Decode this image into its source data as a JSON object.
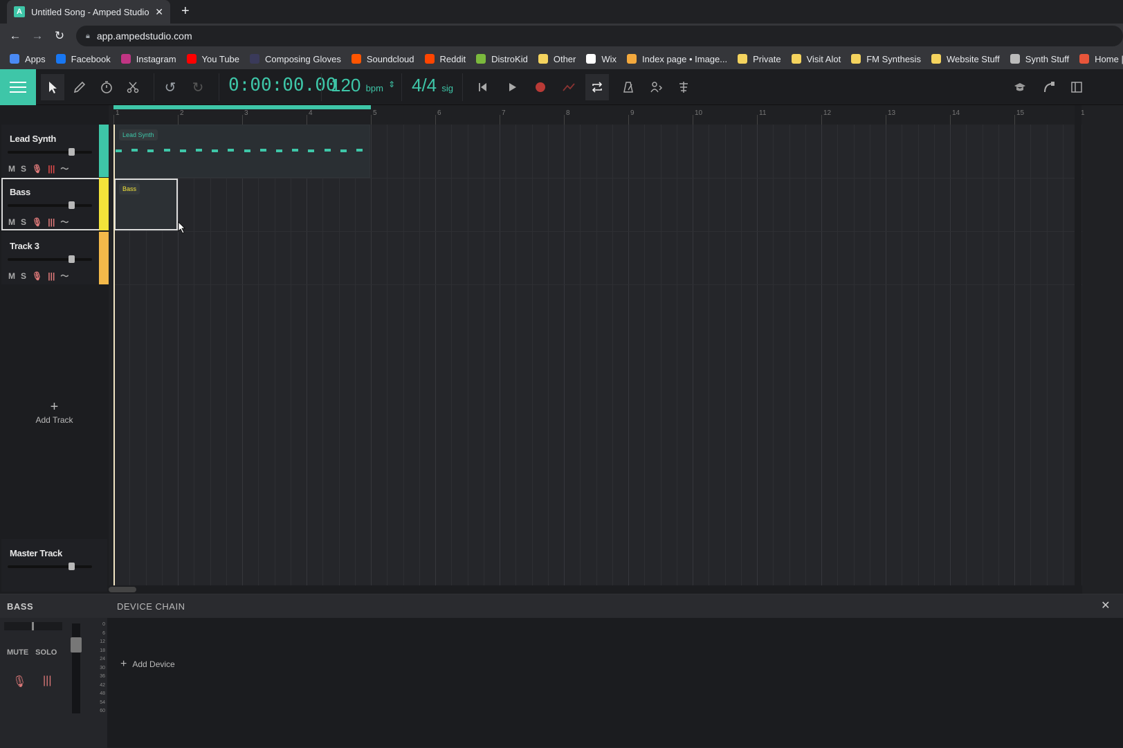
{
  "browser": {
    "tab_title": "Untitled Song - Amped Studio",
    "tab_favicon": "A",
    "tab_close": "✕",
    "new_tab": "+",
    "url": "app.ampedstudio.com",
    "bookmarks": [
      {
        "label": "Apps",
        "color": "#4a8af4"
      },
      {
        "label": "Facebook",
        "color": "#1877f2"
      },
      {
        "label": "Instagram",
        "color": "#c13584"
      },
      {
        "label": "You Tube",
        "color": "#ff0000"
      },
      {
        "label": "Composing Gloves",
        "color": "#3a3a5a"
      },
      {
        "label": "Soundcloud",
        "color": "#ff5500"
      },
      {
        "label": "Reddit",
        "color": "#ff4500"
      },
      {
        "label": "DistroKid",
        "color": "#7bb93d"
      },
      {
        "label": "Other",
        "color": "#f4d35e"
      },
      {
        "label": "Wix",
        "color": "#ffffff"
      },
      {
        "label": "Index page • Image...",
        "color": "#f4a93d"
      },
      {
        "label": "Private",
        "color": "#f4d35e"
      },
      {
        "label": "Visit Alot",
        "color": "#f4d35e"
      },
      {
        "label": "FM Synthesis",
        "color": "#f4d35e"
      },
      {
        "label": "Website Stuff",
        "color": "#f4d35e"
      },
      {
        "label": "Synth Stuff",
        "color": "#bbbbbb"
      },
      {
        "label": "Home | Renoi",
        "color": "#e8553a"
      }
    ]
  },
  "toolbar": {
    "time": "0:00:00.00",
    "bpm_value": "120",
    "bpm_unit": "bpm",
    "sig_value": "4/4",
    "sig_unit": "sig",
    "accent": "#3ec6a8"
  },
  "timeline": {
    "bars": [
      "1",
      "2",
      "3",
      "4",
      "5",
      "6",
      "7",
      "8",
      "9",
      "10",
      "11",
      "12",
      "13",
      "14",
      "15",
      "1"
    ]
  },
  "tracks": [
    {
      "name": "Lead Synth",
      "color": "#3ec6a8",
      "volume": 0.78
    },
    {
      "name": "Bass",
      "color": "#f3e33a",
      "volume": 0.78,
      "selected": true
    },
    {
      "name": "Track 3",
      "color": "#f4b94a",
      "volume": 0.78
    }
  ],
  "track_buttons": {
    "mute": "M",
    "solo": "S"
  },
  "add_track": {
    "plus": "+",
    "label": "Add Track"
  },
  "master": {
    "name": "Master Track",
    "volume": 0.78
  },
  "clips": [
    {
      "label": "Lead Synth",
      "track": 0
    },
    {
      "label": "Bass",
      "track": 1
    }
  ],
  "bottom": {
    "track_name": "BASS",
    "device_chain_title": "DEVICE CHAIN",
    "close": "✕",
    "mute": "MUTE",
    "solo": "SOLO",
    "add_device_plus": "+",
    "add_device": "Add Device",
    "meter_scale": [
      "0",
      "6",
      "12",
      "18",
      "24",
      "30",
      "36",
      "42",
      "48",
      "54",
      "60"
    ]
  }
}
